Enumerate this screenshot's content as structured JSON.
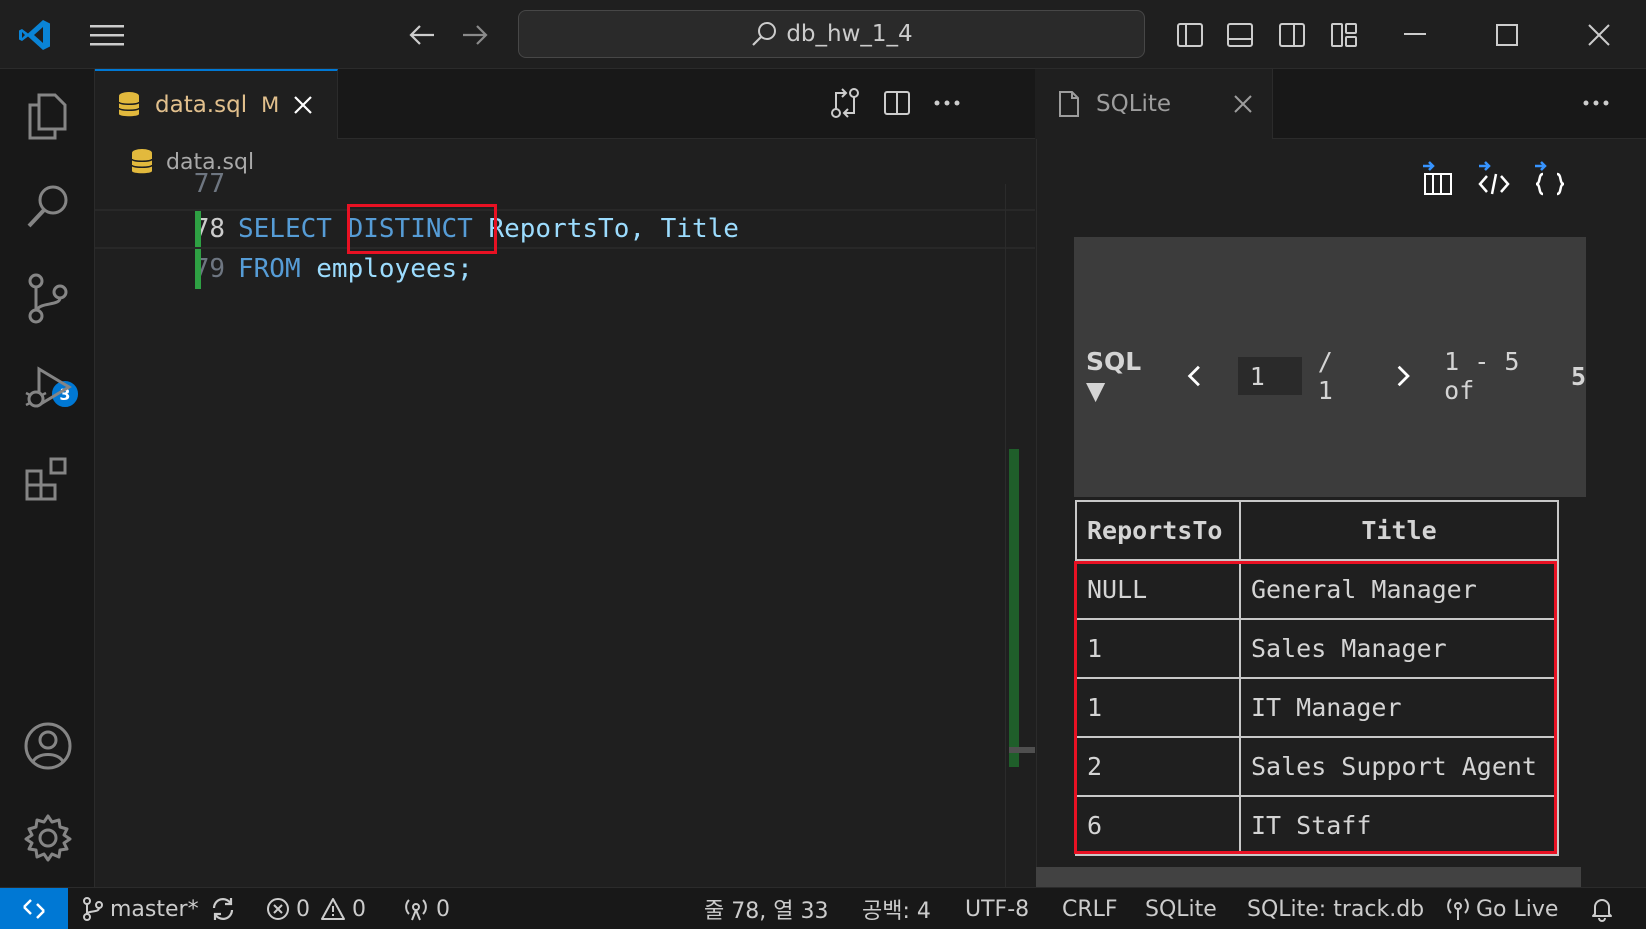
{
  "titlebar": {
    "search_text": "db_hw_1_4"
  },
  "activity": {
    "scm_badge": "3"
  },
  "editor": {
    "tab_label": "data.sql",
    "tab_status": "M",
    "breadcrumb": "data.sql",
    "lines": [
      {
        "num": "77",
        "text": ""
      },
      {
        "num": "78",
        "kw1": "SELECT",
        "kw2": "DISTINCT",
        "rest": "ReportsTo, Title"
      },
      {
        "num": "79",
        "kw1": "FROM",
        "rest": "employees;"
      }
    ]
  },
  "panel": {
    "tab_label": "SQLite",
    "pager": {
      "mode": "SQL ▼",
      "page_value": "1",
      "page_total": "/ 1",
      "range": "1 - 5 of",
      "total": "5"
    },
    "table": {
      "headers": [
        "ReportsTo",
        "Title"
      ],
      "rows": [
        [
          "NULL",
          "General Manager"
        ],
        [
          "1",
          "Sales Manager"
        ],
        [
          "1",
          "IT Manager"
        ],
        [
          "2",
          "Sales Support Agent"
        ],
        [
          "6",
          "IT Staff"
        ]
      ]
    }
  },
  "statusbar": {
    "branch": "master*",
    "errors": "0",
    "warnings": "0",
    "ports": "0",
    "position": "줄 78, 열 33",
    "indent": "공백: 4",
    "encoding": "UTF-8",
    "eol": "CRLF",
    "language": "SQLite",
    "db": "SQLite: track.db",
    "golive": "Go Live"
  },
  "colors": {
    "accent": "#0078d4",
    "highlight": "#e81123",
    "keyword": "#569cd6",
    "identifier": "#9cdcfe"
  }
}
